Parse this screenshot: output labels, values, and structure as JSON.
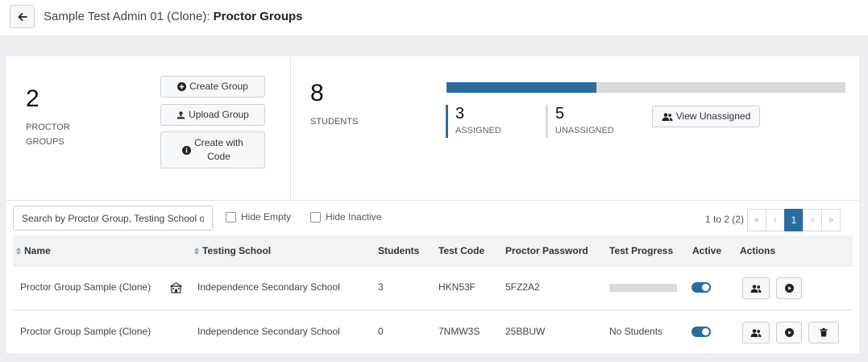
{
  "header": {
    "title_prefix": "Sample Test Admin 01 (Clone): ",
    "title_bold": "Proctor Groups"
  },
  "summary": {
    "groups_count": "2",
    "groups_label_line1": "PROCTOR",
    "groups_label_line2": "GROUPS",
    "create_group_label": "Create Group",
    "upload_group_label": "Upload Group",
    "create_with_code_label_line1": "Create with",
    "create_with_code_label_line2": "Code",
    "students_count": "8",
    "students_label": "STUDENTS",
    "assigned_fraction": 0.375,
    "assigned_count": "3",
    "assigned_label": "ASSIGNED",
    "unassigned_count": "5",
    "unassigned_label": "UNASSIGNED",
    "view_unassigned_label": "View Unassigned"
  },
  "filters": {
    "search_placeholder": "Search by Proctor Group, Testing School or Test Code",
    "hide_empty_label": "Hide Empty",
    "hide_inactive_label": "Hide Inactive"
  },
  "pagination": {
    "info": "1 to 2 (2)",
    "first": "«",
    "prev": "‹",
    "current": "1",
    "next": "›",
    "last": "»"
  },
  "table": {
    "columns": {
      "name": "Name",
      "school": "Testing School",
      "students": "Students",
      "test_code": "Test Code",
      "password": "Proctor Password",
      "progress": "Test Progress",
      "active": "Active",
      "actions": "Actions"
    },
    "rows": [
      {
        "name": "Proctor Group Sample (Clone)",
        "school": "Independence Secondary School",
        "students": "3",
        "test_code": "HKN53F",
        "password": "5FZ2A2",
        "progress": "",
        "active": true
      },
      {
        "name": "Proctor Group Sample (Clone)",
        "school": "Independence Secondary School",
        "students": "0",
        "test_code": "7NMW3S",
        "password": "25BBUW",
        "progress": "No Students",
        "active": true
      }
    ]
  },
  "colors": {
    "accent": "#2b6b9e",
    "unassigned_bar": "#d9d9d9"
  }
}
